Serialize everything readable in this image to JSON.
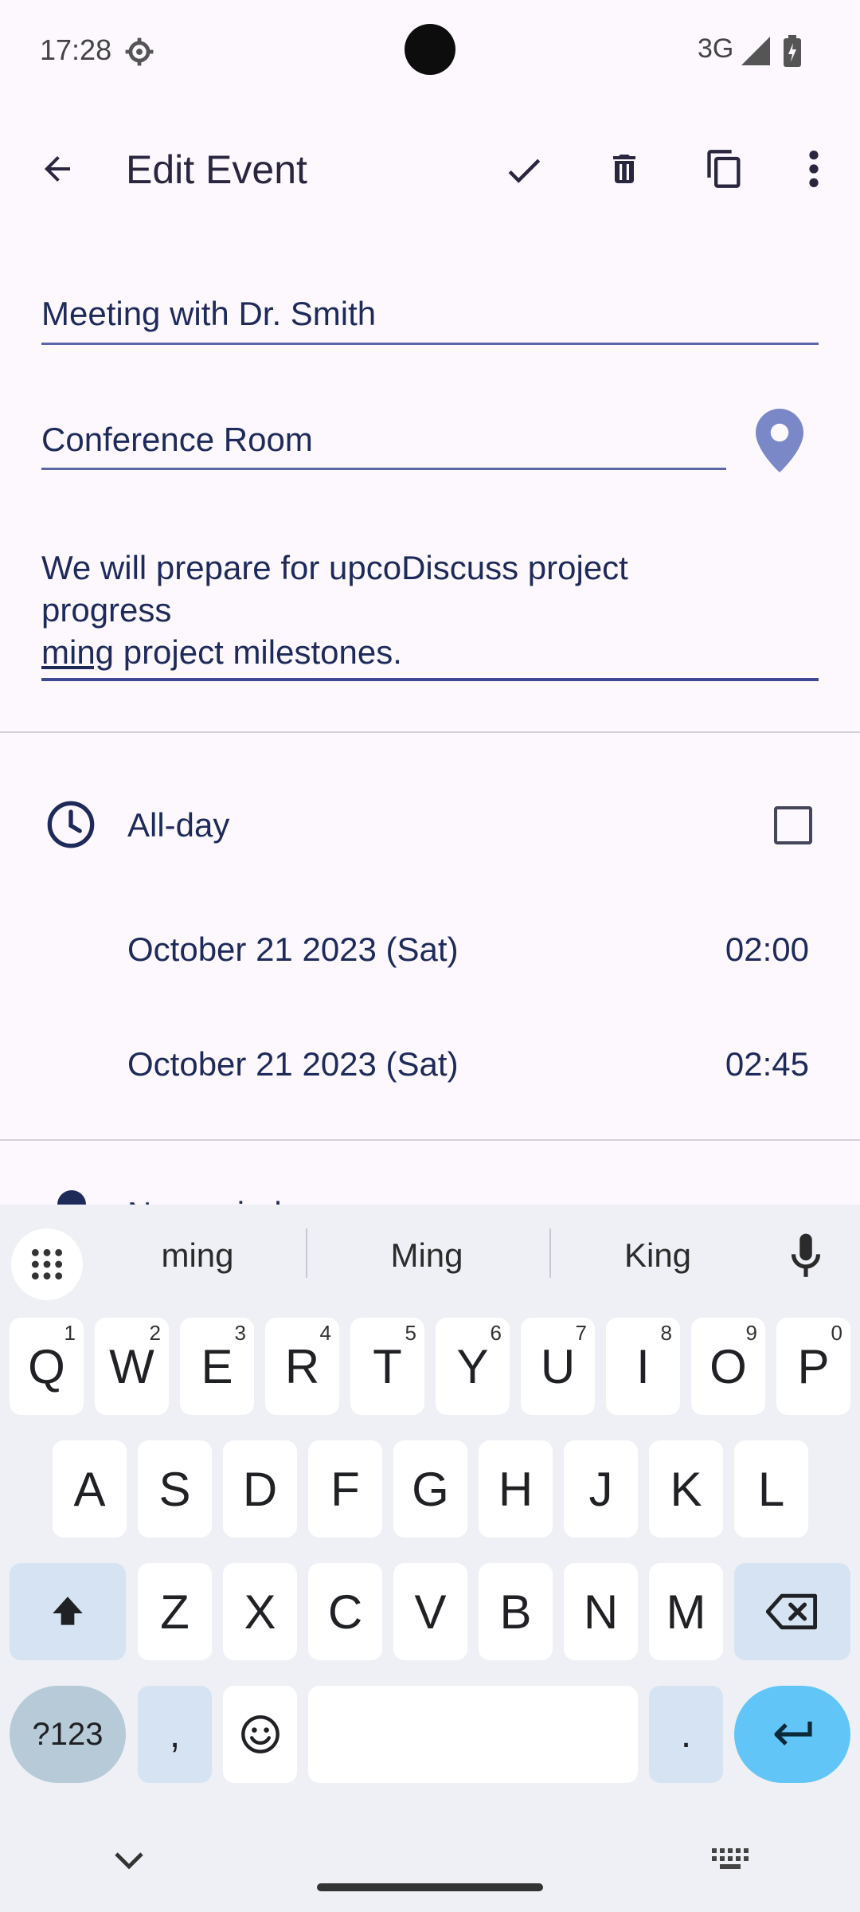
{
  "status": {
    "time": "17:28",
    "network": "3G"
  },
  "app_bar": {
    "title": "Edit Event"
  },
  "form": {
    "title_value": "Meeting with Dr. Smith",
    "location_value": "Conference Room",
    "description_line1": "We will prepare for upcoDiscuss project",
    "description_line2": "progress",
    "description_line3_underlined": "ming",
    "description_line3_rest": " project milestones."
  },
  "allday": {
    "label": "All-day",
    "checked": false
  },
  "start": {
    "date": "October 21 2023 (Sat)",
    "time": "02:00"
  },
  "end": {
    "date": "October 21 2023 (Sat)",
    "time": "02:45"
  },
  "reminder": {
    "label": "No reminder"
  },
  "keyboard": {
    "suggestions": [
      "ming",
      "Ming",
      "King"
    ],
    "row1": [
      {
        "label": "Q",
        "hint": "1"
      },
      {
        "label": "W",
        "hint": "2"
      },
      {
        "label": "E",
        "hint": "3"
      },
      {
        "label": "R",
        "hint": "4"
      },
      {
        "label": "T",
        "hint": "5"
      },
      {
        "label": "Y",
        "hint": "6"
      },
      {
        "label": "U",
        "hint": "7"
      },
      {
        "label": "I",
        "hint": "8"
      },
      {
        "label": "O",
        "hint": "9"
      },
      {
        "label": "P",
        "hint": "0"
      }
    ],
    "row2": [
      "A",
      "S",
      "D",
      "F",
      "G",
      "H",
      "J",
      "K",
      "L"
    ],
    "row3": [
      "Z",
      "X",
      "C",
      "V",
      "B",
      "N",
      "M"
    ],
    "symbols_label": "?123",
    "comma_label": ",",
    "period_label": "."
  }
}
